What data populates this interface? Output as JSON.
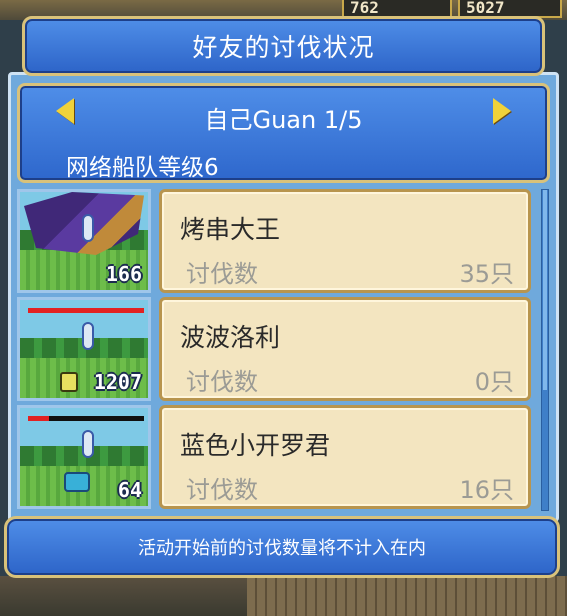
{
  "background": {
    "resource_left": "762",
    "resource_right": "5027"
  },
  "title": "好友的讨伐状况",
  "header": {
    "player": "自己Guan 1/5",
    "fleet_level": "网络船队等级6"
  },
  "entries": [
    {
      "name": "烤串大王",
      "count_label": "讨伐数",
      "count": "35只",
      "power": "166",
      "hp_fraction": null
    },
    {
      "name": "波波洛利",
      "count_label": "讨伐数",
      "count": "0只",
      "power": "1207",
      "hp_fraction": 1.0
    },
    {
      "name": "蓝色小开罗君",
      "count_label": "讨伐数",
      "count": "16只",
      "power": "64",
      "hp_fraction": 0.18
    }
  ],
  "notice": "活动开始前的讨伐数量将不计入在内",
  "colors": {
    "panel_blue": "#2d64c8",
    "gold_border": "#d9c27a",
    "card_bg": "#f3e5c0",
    "hp_red": "#e22222"
  }
}
